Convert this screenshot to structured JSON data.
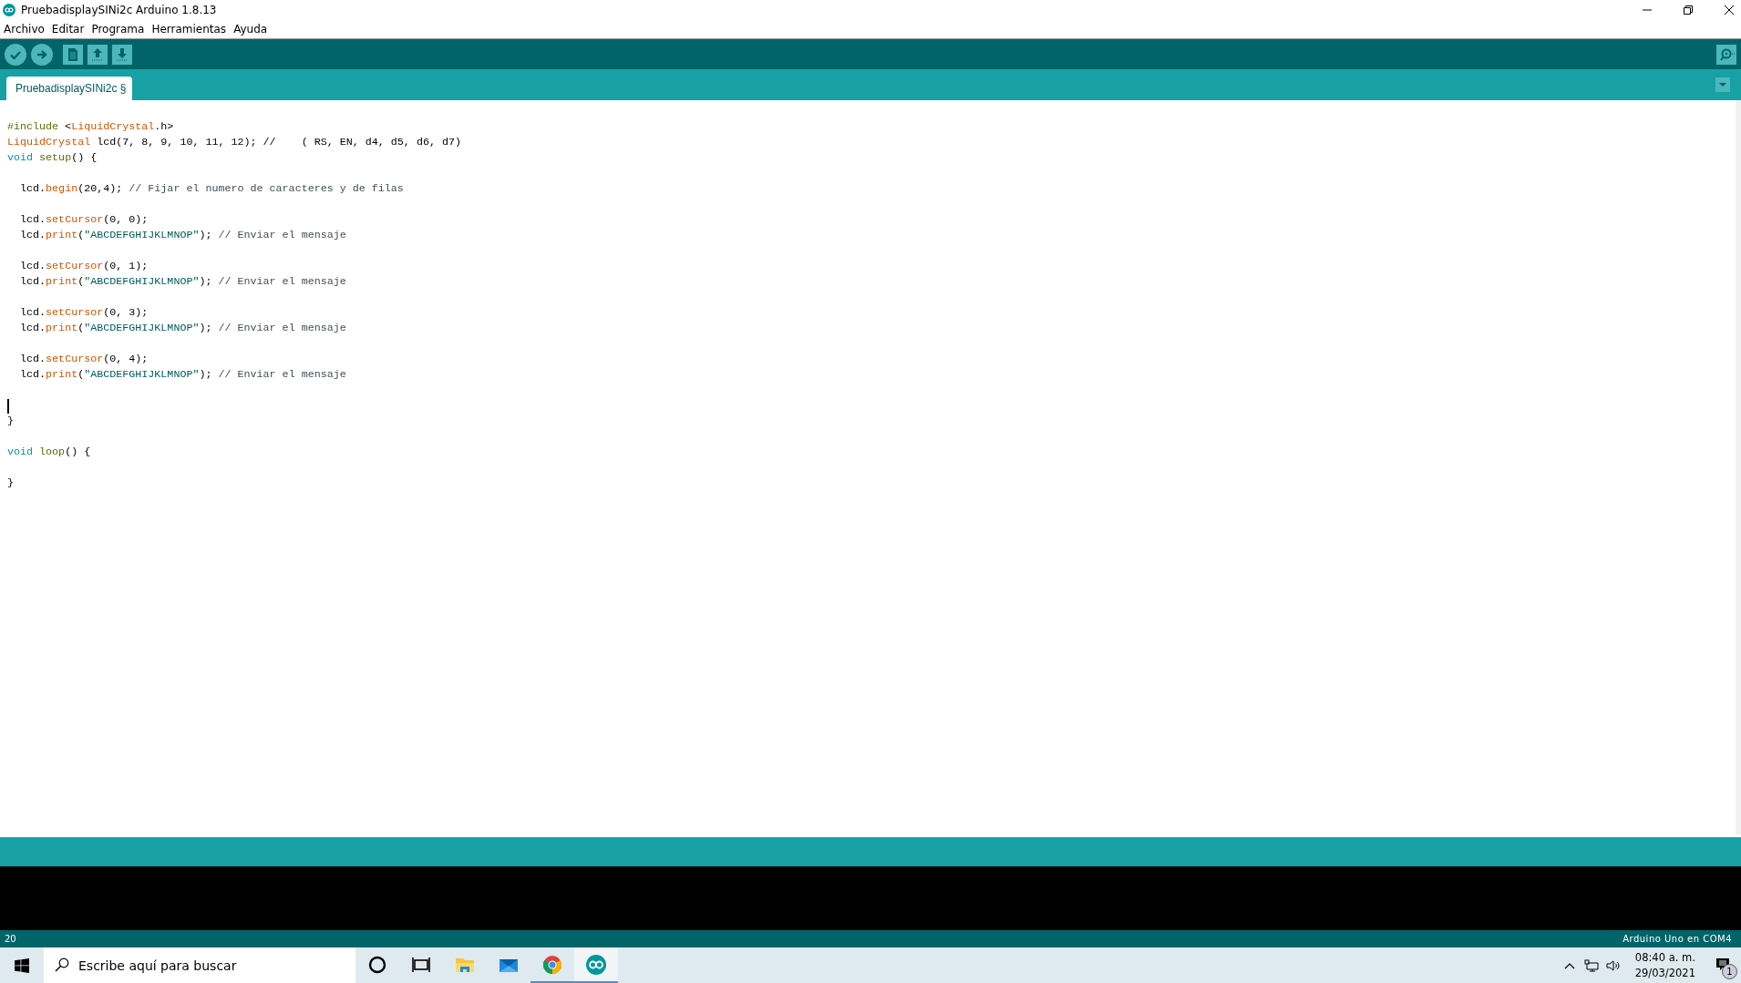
{
  "window": {
    "title": "PruebadisplaySINi2c Arduino 1.8.13"
  },
  "menu": [
    "Archivo",
    "Editar",
    "Programa",
    "Herramientas",
    "Ayuda"
  ],
  "toolbar": [
    {
      "kind": "verify"
    },
    {
      "kind": "upload"
    },
    {
      "kind": "new"
    },
    {
      "kind": "open"
    },
    {
      "kind": "save"
    }
  ],
  "tabs": [
    {
      "label": "PruebadisplaySINi2c §",
      "selected": true
    }
  ],
  "code_blocks": [
    [
      {
        "tokens": [
          {
            "kind": "pre",
            "text": "#include"
          },
          {
            "kind": "plain",
            "text": " <"
          },
          {
            "kind": "keyword",
            "text": "LiquidCrystal"
          },
          {
            "kind": "plain",
            "text": ".h>"
          }
        ]
      },
      {
        "tokens": [
          {
            "kind": "keyword",
            "text": "LiquidCrystal"
          },
          {
            "kind": "plain",
            "text": " lcd(7, 8, 9, 10, 11, 12); //    ( RS, EN, d4, d5, d6, d7)"
          }
        ]
      },
      {
        "tokens": [
          {
            "kind": "type",
            "text": "void"
          },
          {
            "kind": "func",
            "text": "setup"
          },
          {
            "kind": "plain",
            "text": "() {"
          }
        ]
      }
    ],
    [
      {
        "tokens": [
          {
            "kind": "plain",
            "text": "  lcd."
          },
          {
            "kind": "keyword",
            "text": "begin"
          },
          {
            "kind": "plain",
            "text": "(20,4); "
          },
          {
            "kind": "comment",
            "text": "// Fijar el numero de caracteres y de filas"
          }
        ]
      }
    ],
    [
      {
        "tokens": [
          {
            "kind": "plain",
            "text": "  lcd."
          },
          {
            "kind": "keyword",
            "text": "setCursor"
          },
          {
            "kind": "plain",
            "text": "(0, 0);"
          }
        ]
      },
      {
        "tokens": [
          {
            "kind": "plain",
            "text": "  lcd."
          },
          {
            "kind": "keyword",
            "text": "print"
          },
          {
            "kind": "plain",
            "text": "("
          },
          {
            "kind": "string",
            "text": "\"ABCDEFGHIJKLMNOP\""
          },
          {
            "kind": "plain",
            "text": "); "
          },
          {
            "kind": "comment",
            "text": "// Enviar el mensaje"
          }
        ]
      }
    ],
    [
      {
        "tokens": [
          {
            "kind": "plain",
            "text": "  lcd."
          },
          {
            "kind": "keyword",
            "text": "setCursor"
          },
          {
            "kind": "plain",
            "text": "(0, 1);"
          }
        ]
      },
      {
        "tokens": [
          {
            "kind": "plain",
            "text": "  lcd."
          },
          {
            "kind": "keyword",
            "text": "print"
          },
          {
            "kind": "plain",
            "text": "("
          },
          {
            "kind": "string",
            "text": "\"ABCDEFGHIJKLMNOP\""
          },
          {
            "kind": "plain",
            "text": "); "
          },
          {
            "kind": "comment",
            "text": "// Enviar el mensaje"
          }
        ]
      }
    ],
    [
      {
        "tokens": [
          {
            "kind": "plain",
            "text": "  lcd."
          },
          {
            "kind": "keyword",
            "text": "setCursor"
          },
          {
            "kind": "plain",
            "text": "(0, 3);"
          }
        ]
      },
      {
        "tokens": [
          {
            "kind": "plain",
            "text": "  lcd."
          },
          {
            "kind": "keyword",
            "text": "print"
          },
          {
            "kind": "plain",
            "text": "("
          },
          {
            "kind": "string",
            "text": "\"ABCDEFGHIJKLMNOP\""
          },
          {
            "kind": "plain",
            "text": "); "
          },
          {
            "kind": "comment",
            "text": "// Enviar el mensaje"
          }
        ]
      }
    ],
    [
      {
        "tokens": [
          {
            "kind": "plain",
            "text": "  lcd."
          },
          {
            "kind": "keyword",
            "text": "setCursor"
          },
          {
            "kind": "plain",
            "text": "(0, 4);"
          }
        ]
      },
      {
        "tokens": [
          {
            "kind": "plain",
            "text": "  lcd."
          },
          {
            "kind": "keyword",
            "text": "print"
          },
          {
            "kind": "plain",
            "text": "("
          },
          {
            "kind": "string",
            "text": "\"ABCDEFGHIJKLMNOP\""
          },
          {
            "kind": "plain",
            "text": "); "
          },
          {
            "kind": "comment",
            "text": "// Enviar el mensaje"
          }
        ]
      }
    ],
    [
      {
        "caret": true
      },
      {
        "tokens": [
          {
            "kind": "plain",
            "text": "}"
          }
        ]
      }
    ],
    [
      {
        "tokens": [
          {
            "kind": "type",
            "text": "void"
          },
          {
            "kind": "func",
            "text": "loop"
          },
          {
            "kind": "plain",
            "text": "() {"
          }
        ]
      }
    ],
    [
      {
        "tokens": [
          {
            "kind": "plain",
            "text": "}"
          }
        ]
      }
    ]
  ],
  "status_bar": {
    "line": "20",
    "board": "Arduino Uno en COM4"
  },
  "taskbar": {
    "search": {
      "placeholder": "Escribe aquí para buscar"
    },
    "apps": [
      {
        "kind": "cortana",
        "running": false,
        "selected": false
      },
      {
        "kind": "taskview",
        "running": false,
        "selected": false
      },
      {
        "kind": "explorer",
        "running": false,
        "selected": false
      },
      {
        "kind": "mail",
        "running": false,
        "selected": false
      },
      {
        "kind": "chrome",
        "running": true,
        "selected": false
      },
      {
        "kind": "arduino",
        "running": true,
        "selected": true
      }
    ],
    "time": "08:40 a. m.",
    "date": "29/03/2021",
    "notifications": "1"
  }
}
